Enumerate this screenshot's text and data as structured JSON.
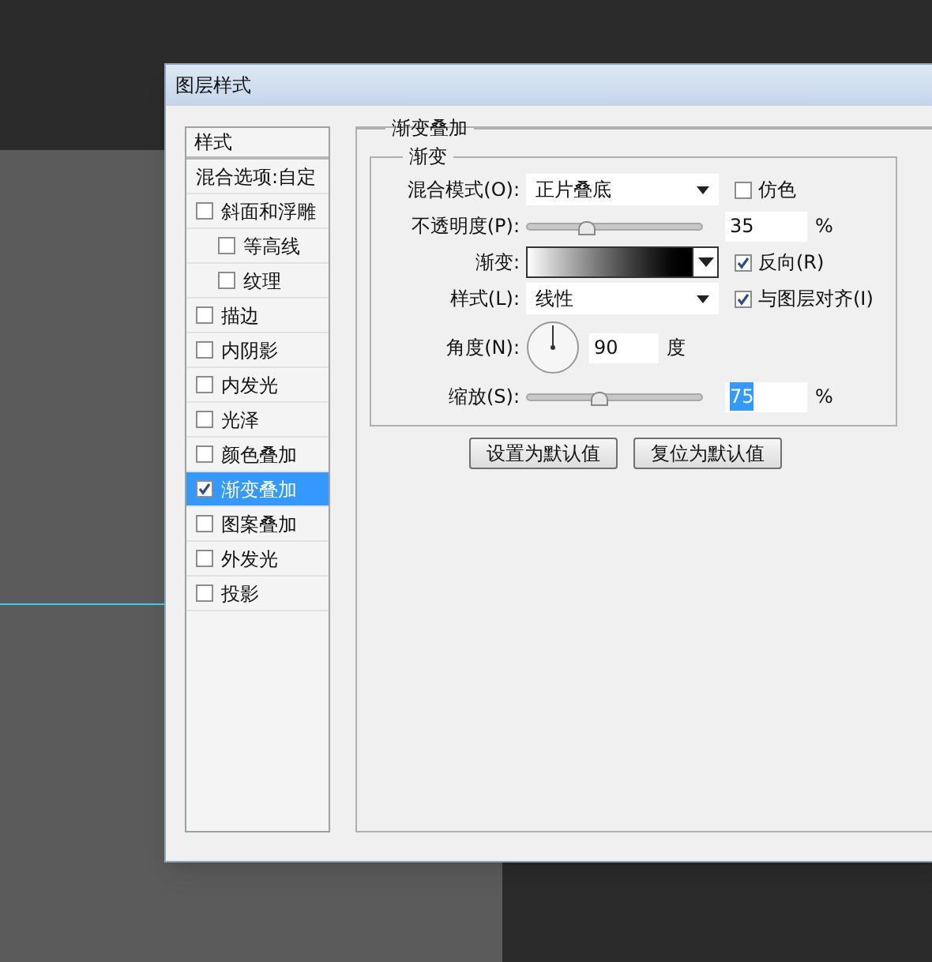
{
  "window": {
    "title": "图层样式"
  },
  "sidebar": {
    "header": "样式",
    "items": [
      {
        "label": "混合选项:自定",
        "kind": "plain",
        "selected": false
      },
      {
        "label": "斜面和浮雕",
        "kind": "check",
        "checked": false,
        "selected": false,
        "children": [
          {
            "label": "等高线",
            "kind": "check",
            "checked": false,
            "selected": false
          },
          {
            "label": "纹理",
            "kind": "check",
            "checked": false,
            "selected": false
          }
        ]
      },
      {
        "label": "描边",
        "kind": "check",
        "checked": false,
        "selected": false
      },
      {
        "label": "内阴影",
        "kind": "check",
        "checked": false,
        "selected": false
      },
      {
        "label": "内发光",
        "kind": "check",
        "checked": false,
        "selected": false
      },
      {
        "label": "光泽",
        "kind": "check",
        "checked": false,
        "selected": false
      },
      {
        "label": "颜色叠加",
        "kind": "check",
        "checked": false,
        "selected": false
      },
      {
        "label": "渐变叠加",
        "kind": "check",
        "checked": true,
        "selected": true
      },
      {
        "label": "图案叠加",
        "kind": "check",
        "checked": false,
        "selected": false
      },
      {
        "label": "外发光",
        "kind": "check",
        "checked": false,
        "selected": false
      },
      {
        "label": "投影",
        "kind": "check",
        "checked": false,
        "selected": false
      }
    ]
  },
  "panel": {
    "title": "渐变叠加",
    "group_title": "渐变",
    "blend_mode": {
      "label": "混合模式(O):",
      "value": "正片叠底"
    },
    "dither": {
      "label": "仿色",
      "checked": false
    },
    "opacity": {
      "label": "不透明度(P):",
      "level": 0.34,
      "value": "35",
      "unit": "%"
    },
    "gradient": {
      "label": "渐变:"
    },
    "reverse": {
      "label": "反向(R)",
      "checked": true
    },
    "style": {
      "label": "样式(L):",
      "value": "线性"
    },
    "align": {
      "label": "与图层对齐(I)",
      "checked": true
    },
    "angle": {
      "label": "角度(N):",
      "value": "90",
      "unit": "度"
    },
    "scale": {
      "label": "缩放(S):",
      "level": 0.41,
      "value": "75",
      "unit": "%",
      "text_selected": true
    },
    "buttons": [
      "设置为默认值",
      "复位为默认值"
    ]
  }
}
